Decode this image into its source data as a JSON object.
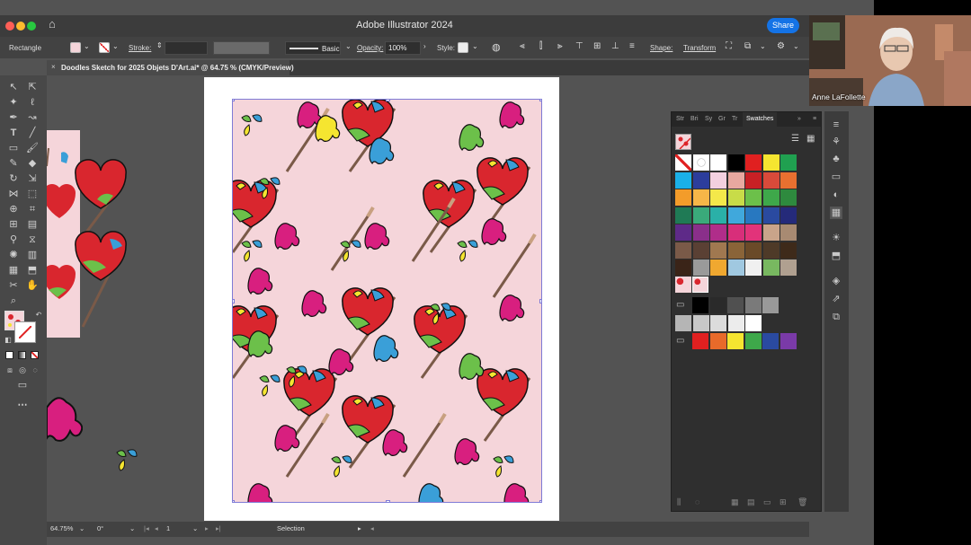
{
  "app": {
    "title": "Adobe Illustrator 2024",
    "share_label": "Share"
  },
  "control_bar": {
    "selection_type": "Rectangle",
    "stroke_label": "Stroke:",
    "brush_label": "Basic",
    "opacity_label": "Opacity:",
    "opacity_value": "100%",
    "style_label": "Style:",
    "shape_label": "Shape:",
    "transform_label": "Transform"
  },
  "document_tab": {
    "close": "×",
    "title": "Doodles Sketch for 2025 Objets D'Art.ai* @ 64.75 % (CMYK/Preview)"
  },
  "status_bar": {
    "zoom": "64.75%",
    "rotation": "0°",
    "artboard": "1",
    "mode": "Selection"
  },
  "swatches_panel": {
    "tabs": [
      "Str",
      "Bri",
      "Sy",
      "Gr",
      "Tr",
      "Swatches"
    ],
    "active_tab": "Swatches",
    "rows": [
      [
        "#ffffff",
        "#ffffff",
        "#ffffff",
        "#000000",
        "#e02020",
        "#f5e530",
        "#20a050"
      ],
      [
        "#1ab0e8",
        "#2c3d9c",
        "#f3d0e0",
        "#e8a8a0",
        "#c82025",
        "#d94a3a",
        "#e87030"
      ],
      [
        "#f39c2a",
        "#f6b648",
        "#f4e84a",
        "#c8dc48",
        "#6cc04a",
        "#3ea84a",
        "#2e8a3e"
      ],
      [
        "#1f7a55",
        "#3aaa7a",
        "#2ab0a8",
        "#40a8dc",
        "#2878c0",
        "#2a4aa0",
        "#252a7a"
      ],
      [
        "#5e2a88",
        "#8a2f8a",
        "#b02d8a",
        "#d82e7a",
        "#e2337a",
        "#c9a48a",
        "#a88a72"
      ],
      [
        "#7a5a48",
        "#5a4034",
        "#a07850",
        "#8a6438",
        "#6a4a28",
        "#4e3a28",
        "#3e2a1a"
      ],
      [
        "#3a2418",
        "#9a9a9a",
        "#f0a830",
        "#a0c8e0",
        "#f0f0f0",
        "#78b860",
        "#b0a090"
      ]
    ],
    "grays": [
      "#000000",
      "#2a2a2a",
      "#505050",
      "#7a7a7a",
      "#999999"
    ],
    "grays2": [
      "#b5b5b5",
      "#c8c8c8",
      "#dcdcdc",
      "#ececec",
      "#ffffff"
    ],
    "group_colors": [
      "#e02020",
      "#e86a2a",
      "#f5e530",
      "#3ea84a",
      "#2a4aa0",
      "#7a3aa8"
    ]
  },
  "video": {
    "participant_name": "Anne LaFollette"
  },
  "colors": {
    "accent": "#1473e6",
    "pattern_bg": "#f5d5da",
    "heart": "#d9262e",
    "selection": "#7f7bd6"
  }
}
